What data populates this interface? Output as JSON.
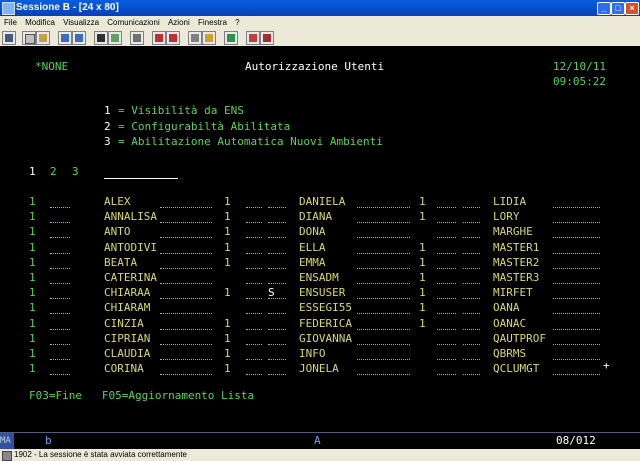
{
  "window": {
    "title": "Sessione B - [24 x 80]"
  },
  "menu": [
    "File",
    "Modifica",
    "Visualizza",
    "Comunicazioni",
    "Azioni",
    "Finestra",
    "?"
  ],
  "toolbar_icons": [
    "print-icon",
    "copy-icon",
    "paste-icon",
    "send-icon",
    "receive-icon",
    "display-icon",
    "color-icon",
    "keyboard-icon",
    "macro-record-icon",
    "macro-play-icon",
    "macro-stop-icon",
    "support-icon",
    "index-icon",
    "help-icon"
  ],
  "screen": {
    "system": "*NONE",
    "title": "Autorizzazione Utenti",
    "date": "12/10/11",
    "time": "09:05:22",
    "legend": [
      {
        "key": "1",
        "text": "= Visibilità da ENS"
      },
      {
        "key": "2",
        "text": "= Configurabiltà Abilitata"
      },
      {
        "key": "3",
        "text": "= Abilitazione Automatica Nuovi Ambienti"
      }
    ],
    "column_headers": [
      "1",
      "2",
      "3"
    ],
    "rows": [
      {
        "c1": "1",
        "u1": "ALEX",
        "v1": "1",
        "s1": "",
        "u2": "DANIELA",
        "v2": "1",
        "s2": "",
        "u3": "LIDIA"
      },
      {
        "c1": "1",
        "u1": "ANNALISA",
        "v1": "1",
        "s1": "",
        "u2": "DIANA",
        "v2": "1",
        "s2": "",
        "u3": "LORY"
      },
      {
        "c1": "1",
        "u1": "ANTO",
        "v1": "1",
        "s1": "",
        "u2": "DONA",
        "v2": "",
        "s2": "",
        "u3": "MARGHE"
      },
      {
        "c1": "1",
        "u1": "ANTODIVI",
        "v1": "1",
        "s1": "",
        "u2": "ELLA",
        "v2": "1",
        "s2": "",
        "u3": "MASTER1"
      },
      {
        "c1": "1",
        "u1": "BEATA",
        "v1": "1",
        "s1": "",
        "u2": "EMMA",
        "v2": "1",
        "s2": "",
        "u3": "MASTER2"
      },
      {
        "c1": "1",
        "u1": "CATERINA",
        "v1": "",
        "s1": "",
        "u2": "ENSADM",
        "v2": "1",
        "s2": "",
        "u3": "MASTER3"
      },
      {
        "c1": "1",
        "u1": "CHIARAA",
        "v1": "1",
        "s1": "S",
        "u2": "ENSUSER",
        "v2": "1",
        "s2": "",
        "u3": "MIRFET"
      },
      {
        "c1": "1",
        "u1": "CHIARAM",
        "v1": "",
        "s1": "",
        "u2": "ESSEGI55",
        "v2": "1",
        "s2": "",
        "u3": "OANA"
      },
      {
        "c1": "1",
        "u1": "CINZIA",
        "v1": "1",
        "s1": "",
        "u2": "FEDERICA",
        "v2": "1",
        "s2": "",
        "u3": "OANAC"
      },
      {
        "c1": "1",
        "u1": "CIPRIAN",
        "v1": "1",
        "s1": "",
        "u2": "GIOVANNA",
        "v2": "",
        "s2": "",
        "u3": "QAUTPROF"
      },
      {
        "c1": "1",
        "u1": "CLAUDIA",
        "v1": "1",
        "s1": "",
        "u2": "INFO",
        "v2": "",
        "s2": "",
        "u3": "QBRMS"
      },
      {
        "c1": "1",
        "u1": "CORINA",
        "v1": "1",
        "s1": "",
        "u2": "JONELA",
        "v2": "",
        "s2": "",
        "u3": "QCLUMGT"
      }
    ],
    "more_indicator": "+",
    "fkeys": "F03=Fine   F05=Aggiornamento Lista"
  },
  "status": {
    "ma": "MA",
    "mode": "b",
    "field": "A",
    "cursor": "08/012"
  },
  "message": "1902 - La sessione è stata avviata correttamente",
  "colors": {
    "green": "#5ad35a",
    "white": "#ffffff",
    "yellow": "#d8d870",
    "background": "#000000"
  }
}
